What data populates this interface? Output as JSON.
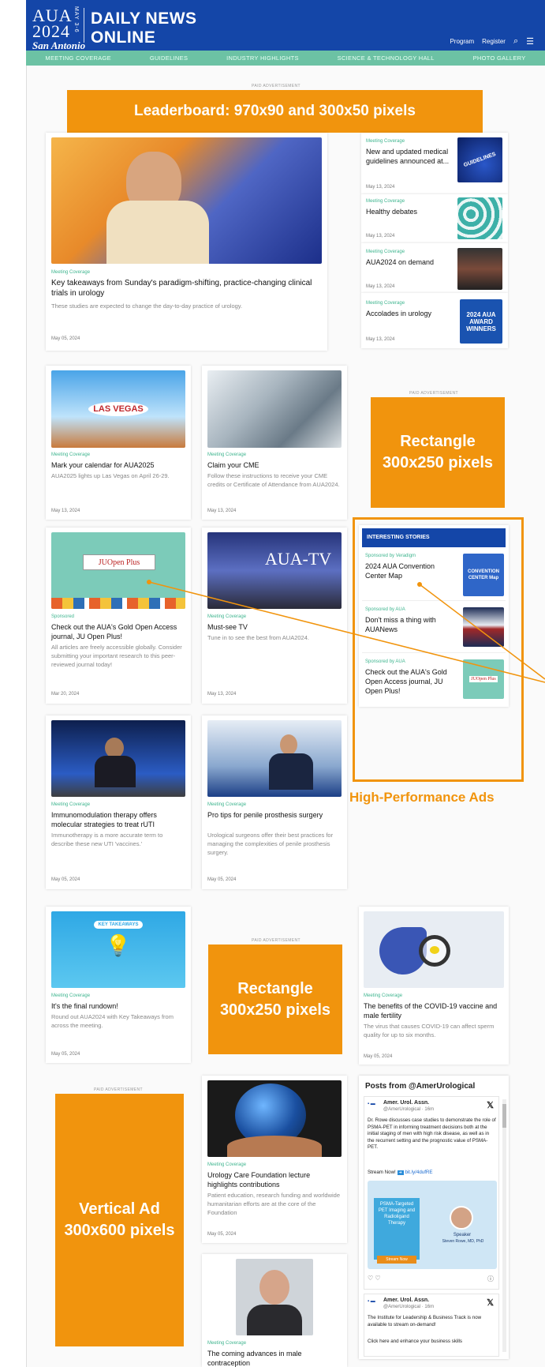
{
  "header": {
    "logo_line1": "AUA",
    "logo_line2": "2024",
    "logo_line3": "San Antonio",
    "logo_dates": "MAY 3-6",
    "brand_line1": "DAILY NEWS",
    "brand_line2": "ONLINE",
    "links": [
      "Program",
      "Register"
    ],
    "icons": [
      "search-icon",
      "menu-icon"
    ]
  },
  "nav": [
    "MEETING COVERAGE",
    "GUIDELINES",
    "INDUSTRY HIGHLIGHTS",
    "SCIENCE & TECHNOLOGY HALL",
    "PHOTO GALLERY"
  ],
  "ads": {
    "paid_label": "PAID ADVERTISEMENT",
    "leaderboard": "Leaderboard: 970x90 and 300x50 pixels",
    "rect1_line1": "Rectangle",
    "rect1_line2": "300x250 pixels",
    "rect2_line1": "Rectangle",
    "rect2_line2": "300x250 pixels",
    "vertical_line1": "Vertical Ad",
    "vertical_line2": "300x600 pixels",
    "high_performance_label": "High-Performance Ads"
  },
  "hero": {
    "category": "Meeting Coverage",
    "title": "Key takeaways from Sunday's paradigm-shifting, practice-changing clinical trials in urology",
    "desc": "These studies are expected to change the day-to-day practice of urology.",
    "date": "May 05, 2024"
  },
  "side_list": [
    {
      "category": "Meeting Coverage",
      "title": "New and updated medical guidelines announced at...",
      "date": "May 13, 2024",
      "thumb_text": "GUIDELINES"
    },
    {
      "category": "Meeting Coverage",
      "title": "Healthy debates",
      "date": "May 13, 2024",
      "thumb_text": ""
    },
    {
      "category": "Meeting Coverage",
      "title": "AUA2024 on demand",
      "date": "May 13, 2024",
      "thumb_text": ""
    },
    {
      "category": "Meeting Coverage",
      "title": "Accolades in urology",
      "date": "May 13, 2024",
      "thumb_text": "2024 AUA AWARD WINNERS"
    }
  ],
  "cards": [
    {
      "category": "Meeting Coverage",
      "title": "Mark your calendar for AUA2025",
      "desc": "AUA2025 lights up Las Vegas on April 26-29.",
      "date": "May 13, 2024",
      "thumb_text": "LAS VEGAS"
    },
    {
      "category": "Meeting Coverage",
      "title": "Claim your CME",
      "desc": "Follow these instructions to receive your CME credits or Certificate of Attendance from AUA2024.",
      "date": "May 13, 2024"
    },
    {
      "category": "Sponsored",
      "title": "Check out the AUA's Gold Open Access journal, JU Open Plus!",
      "desc": "All articles are freely accessible globally. Consider submitting your important research to this peer-reviewed journal today!",
      "date": "Mar 20, 2024",
      "thumb_text": "JUOpen Plus"
    },
    {
      "category": "Meeting Coverage",
      "title": "Must-see TV",
      "desc": "Tune in to see the best from AUA2024.",
      "date": "May 13, 2024",
      "thumb_text": "AUA-TV"
    },
    {
      "category": "Meeting Coverage",
      "title": "Immunomodulation therapy offers molecular strategies to treat rUTI",
      "desc": "Immunotherapy is a more accurate term to describe these new UTI 'vaccines.'",
      "date": "May 05, 2024"
    },
    {
      "category": "Meeting Coverage",
      "title": "Pro tips for penile prosthesis surgery",
      "desc": "Urological surgeons offer their best practices for managing the complexities of penile prosthesis surgery.",
      "date": "May 05, 2024"
    },
    {
      "category": "Meeting Coverage",
      "title": "It's the final rundown!",
      "desc": "Round out AUA2024 with Key Takeaways from across the meeting.",
      "date": "May 05, 2024",
      "thumb_text": "KEY TAKEAWAYS"
    },
    {
      "category": "Meeting Coverage",
      "title": "The benefits of the COVID-19 vaccine and male fertility",
      "desc": "The virus that causes COVID-19 can affect sperm quality for up to six months.",
      "date": "May 05, 2024"
    },
    {
      "category": "Meeting Coverage",
      "title": "Urology Care Foundation lecture highlights contributions",
      "desc": "Patient education, research funding and worldwide humanitarian efforts are at the core of the Foundation",
      "date": "May 05, 2024"
    },
    {
      "category": "Meeting Coverage",
      "title": "The coming advances in male contraception"
    }
  ],
  "interesting": {
    "header": "INTERESTING STORIES",
    "items": [
      {
        "sponsor": "Sponsored by Veradigm",
        "title": "2024 AUA Convention Center Map",
        "thumb_text": "CONVENTION CENTER Map"
      },
      {
        "sponsor": "Sponsored by AUA",
        "title": "Don't miss a thing with AUANews",
        "thumb_text": ""
      },
      {
        "sponsor": "Sponsored by AUA",
        "title": "Check out the AUA's Gold Open Access journal, JU Open Plus!",
        "thumb_text": "JUOpen Plus"
      }
    ]
  },
  "tweets": {
    "title": "Posts from @AmerUrological",
    "items": [
      {
        "name": "Amer. Urol. Assn.",
        "handle": "@AmerUrological · 16m",
        "text": "Dr. Rowe discusses case studies to demonstrate the role of PSMA-PET in informing treatment decisions both at the initial staging of men with high risk disease, as well as in the recurrent setting and the prognostic value of PSMA-PET.",
        "stream": "Stream Now!",
        "link": "bit.ly/4dufRE",
        "media_title": "PSMA-Targeted PET Imaging and Radioligand Therapy",
        "media_button": "Stream Now",
        "speaker_label": "Speaker",
        "speaker_name": "Steven Rowe, MD, PhD"
      },
      {
        "name": "Amer. Urol. Assn.",
        "handle": "@AmerUrological · 16m",
        "text": "The Institute for Leadership & Business Track is now available to stream on-demand!",
        "stream": "Click here and enhance your business skills"
      }
    ]
  },
  "colors": {
    "header_blue": "#1446a8",
    "nav_green": "#6cc2a4",
    "ad_orange": "#f1940d",
    "category_green": "#3fb58f"
  }
}
